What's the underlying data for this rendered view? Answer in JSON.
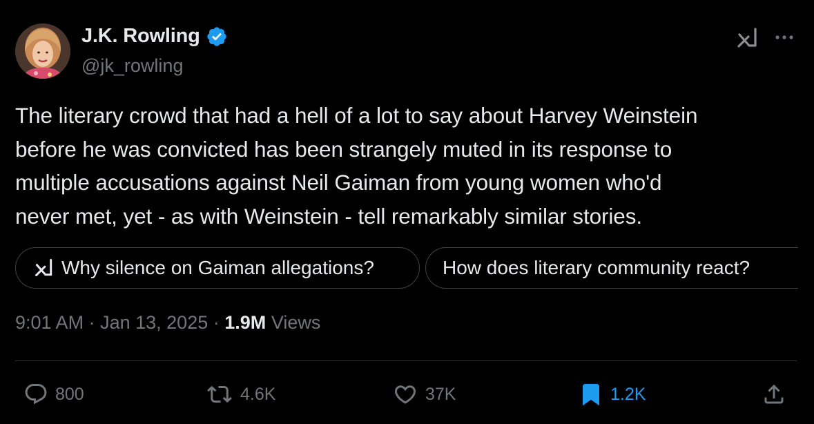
{
  "author": {
    "display_name": "J.K. Rowling",
    "handle": "@jk_rowling",
    "verified": true
  },
  "tweet": {
    "lines": [
      "The literary crowd that had a hell of a lot to say about Harvey Weinstein",
      "before he was convicted has been strangely muted in its response to",
      "multiple accusations against Neil Gaiman from young women who'd",
      "never met, yet - as with Weinstein - tell remarkably similar stories."
    ]
  },
  "grok_suggestions": [
    {
      "label": "Why silence on Gaiman allegations?"
    },
    {
      "label": "How does literary community react?"
    }
  ],
  "meta": {
    "time": "9:01 AM",
    "separator": "·",
    "date": "Jan 13, 2025",
    "views_count": "1.9M",
    "views_label": "Views"
  },
  "actions": {
    "replies": "800",
    "reposts": "4.6K",
    "likes": "37K",
    "bookmarks": "1.2K"
  },
  "colors": {
    "background": "#000000",
    "text": "#e7e9ea",
    "secondary": "#71767b",
    "accent": "#1d9bf0",
    "border": "#2f3336"
  },
  "icons": {
    "verified": "verified-badge-icon",
    "grok": "grok-icon",
    "more": "more-dots-icon",
    "reply": "reply-bubble-icon",
    "repost": "repost-arrows-icon",
    "like": "heart-icon",
    "bookmark": "bookmark-filled-icon",
    "share": "share-upload-icon"
  }
}
